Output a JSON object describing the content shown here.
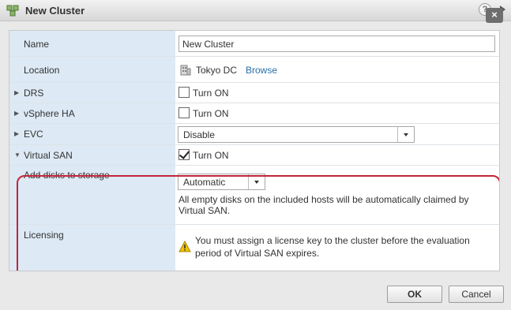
{
  "window": {
    "title": "New Cluster",
    "icons": {
      "title": "cluster-icon",
      "help": "help-icon",
      "expand": "expand-icon",
      "close": "close-icon"
    },
    "help_glyph": "?",
    "close_glyph": "×"
  },
  "form": {
    "name": {
      "label": "Name",
      "value": "New Cluster"
    },
    "location": {
      "label": "Location",
      "value": "Tokyo DC",
      "browse_link": "Browse",
      "icon": "datacenter-icon"
    },
    "drs": {
      "label": "DRS",
      "checkbox_label": "Turn ON",
      "checked": false
    },
    "vsphere_ha": {
      "label": "vSphere HA",
      "checkbox_label": "Turn ON",
      "checked": false
    },
    "evc": {
      "label": "EVC",
      "selected": "Disable"
    },
    "virtual_san": {
      "label": "Virtual SAN",
      "checkbox_label": "Turn ON",
      "checked": true
    },
    "add_disks": {
      "label": "Add disks to storage",
      "selected": "Automatic",
      "description": "All empty disks on the included hosts will be automatically claimed by Virtual SAN."
    },
    "licensing": {
      "label": "Licensing",
      "warning": "You must assign a license key to the cluster before the evaluation period of Virtual SAN expires.",
      "icon": "warning-icon"
    }
  },
  "footer": {
    "ok_label": "OK",
    "cancel_label": "Cancel"
  },
  "colors": {
    "highlight": "#c3253a",
    "label_column": "#dde9f4",
    "link": "#2a6fa8",
    "warning": "#f2c200"
  }
}
